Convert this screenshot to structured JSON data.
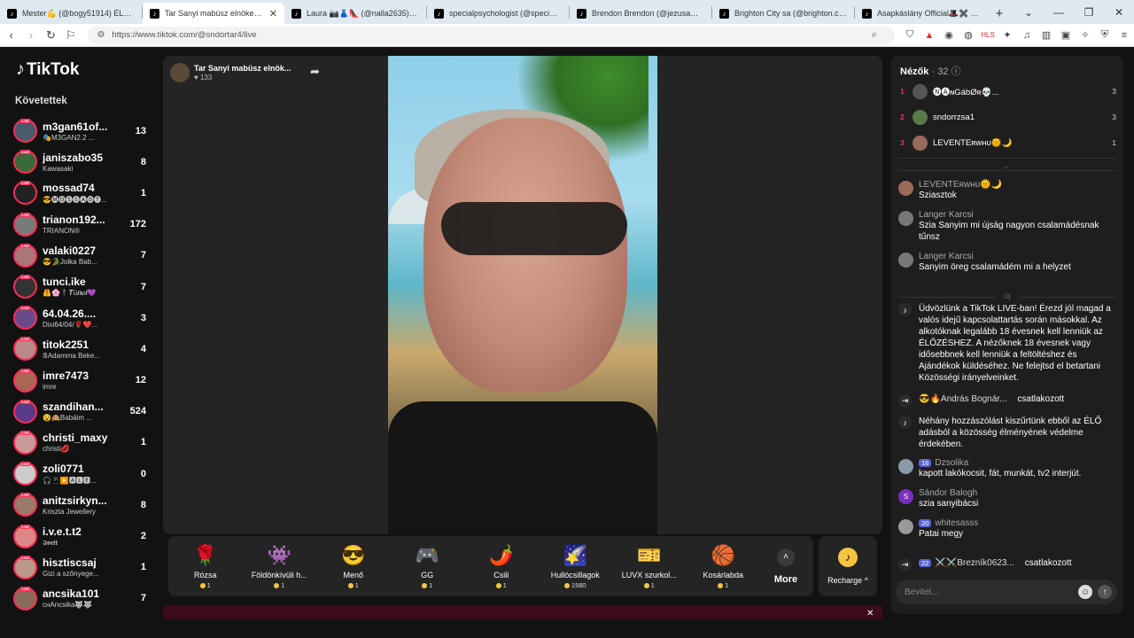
{
  "browser": {
    "tabs": [
      {
        "title": "Mester💪 (@bogy51914) ÉLŐ adá",
        "active": false
      },
      {
        "title": "Tar Sanyi mabüsz elnöke Be",
        "active": true
      },
      {
        "title": "Laura 📷👗👠 (@nalla2635) ÉLŐ ad",
        "active": false
      },
      {
        "title": "specialpsychologist (@specialpsych",
        "active": false
      },
      {
        "title": "Brendon Brendon (@jezusamegval",
        "active": false
      },
      {
        "title": "Brighton City sa (@brighton.city) É",
        "active": false
      },
      {
        "title": "Asapkáslány Official🎩✖️ (@therea",
        "active": false
      }
    ],
    "url": "https://www.tiktok.com/@sndortar4/live"
  },
  "sidebar": {
    "logo": "TikTok",
    "following_title": "Követettek",
    "live_badge": "LIVE",
    "items": [
      {
        "name": "m3gan61of...",
        "sub": "🎭M3GAN2.2 ...",
        "count": "13"
      },
      {
        "name": "janiszabo35",
        "sub": "Kawasaki",
        "count": "8"
      },
      {
        "name": "mossad74",
        "sub": "😎🅜🅞🅢🅢🅐🅓🅣...",
        "count": "1"
      },
      {
        "name": "trianon192...",
        "sub": "TRIANON®",
        "count": "172"
      },
      {
        "name": "valaki0227",
        "sub": "😎🐊Jolka Bab...",
        "count": "7"
      },
      {
        "name": "tunci.ike",
        "sub": "🦺🌸🕴𝑻ü𝒏𝒄𝒊💜",
        "count": "7"
      },
      {
        "name": "64.04.26....",
        "sub": "Dixi64/04/🌹❤️...",
        "count": "3"
      },
      {
        "name": "titok2251",
        "sub": "𝔹Adamma Beke...",
        "count": "4"
      },
      {
        "name": "imre7473",
        "sub": "imre",
        "count": "12"
      },
      {
        "name": "szandihan...",
        "sub": "😵🙈Babáim ...",
        "count": "524"
      },
      {
        "name": "christi_maxy",
        "sub": "christi💋",
        "count": "1"
      },
      {
        "name": "zoli0771",
        "sub": "🎧📱▶️🅰🅻🅴...",
        "count": "0"
      },
      {
        "name": "anitzsirkyn...",
        "sub": "Kriszta Jewellery",
        "count": "8"
      },
      {
        "name": "i.v.e.t.t2",
        "sub": "𝕴𝖛𝖊𝖙𝖙",
        "count": "2"
      },
      {
        "name": "hisztiscsaj",
        "sub": "Gizi a szőnyege...",
        "count": "1"
      },
      {
        "name": "ancsika101",
        "sub": "ᴄʜAncsika🐺🐺",
        "count": "7"
      }
    ]
  },
  "stream": {
    "host_name": "Tar Sanyi mabüsz elnök...",
    "likes": "♥ 133"
  },
  "gifts": [
    {
      "name": "Rózsa",
      "icon": "🌹",
      "price": "1"
    },
    {
      "name": "Földönkívüli h...",
      "icon": "👾",
      "price": "1"
    },
    {
      "name": "Menő",
      "icon": "😎",
      "price": "1"
    },
    {
      "name": "GG",
      "icon": "🎮",
      "price": "1"
    },
    {
      "name": "Csili",
      "icon": "🌶️",
      "price": "1"
    },
    {
      "name": "Hullócsillagok",
      "icon": "🌠",
      "price": "1580"
    },
    {
      "name": "LUVX szurkol...",
      "icon": "🎫",
      "price": "1"
    },
    {
      "name": "Kosárlabda",
      "icon": "🏀",
      "price": "1"
    }
  ],
  "more_label": "More",
  "recharge_label": "Recharge ^",
  "viewers": {
    "title": "Nézők",
    "count": "· 32",
    "top": [
      {
        "rank": "1",
        "name": "🅝🅐ɴGábØʀ💀...",
        "value": "3"
      },
      {
        "rank": "2",
        "name": "sndorrzsa1",
        "value": "3"
      },
      {
        "rank": "3",
        "name": "LEVENTEʀᴡʜᴜ🌞🌙",
        "value": "1"
      }
    ]
  },
  "chat": {
    "msg1": {
      "name": "LEVENTEʀᴡʜᴜ🌞🌙",
      "text": "Sziasztok"
    },
    "msg2": {
      "name": "Langer Karcsi",
      "text": "Szia Sanyim mi újság nagyon csalamádésnak tűnsz"
    },
    "msg3": {
      "name": "Langer Karcsi",
      "text": "Sanyim öreg csalamádém mi a helyzet"
    },
    "new_label": "Új",
    "sys1": "Üdvözlünk a TikTok LIVE-ban! Érezd jól magad a valós idejű kapcsolattartás során másokkal. Az alkotóknak legalább 18 évesnek kell lenniük az ÉLŐZÉSHEZ. A nézőknek 18 évesnek vagy idősebbnek kell lenniük a feltöltéshez és Ajándékok küldéséhez. Ne felejtsd el betartani Közösségi irányelveinket.",
    "join1": {
      "name": "😎🔥András Bognár...",
      "action": "csatlakozott"
    },
    "sys2": "Néhány hozzászólást kiszűrtünk ebből az ÉLŐ adásból a közösség élményének védelme érdekében.",
    "msg4": {
      "badge": "16",
      "name": "Dzsolika",
      "text": "kapott lakókocsit, fát, munkát, tv2 interjút."
    },
    "msg5": {
      "avatar_letter": "S",
      "name": "Sándor Balogh",
      "text": "szia sanyibácsi"
    },
    "msg6": {
      "badge": "20",
      "name": "whitesasss",
      "text": "Patai megy"
    },
    "join2": {
      "badge": "22",
      "name": "⚔️⚔️Brezník0623...",
      "action": "csatlakozott"
    }
  },
  "input": {
    "placeholder": "Bevitel..."
  }
}
